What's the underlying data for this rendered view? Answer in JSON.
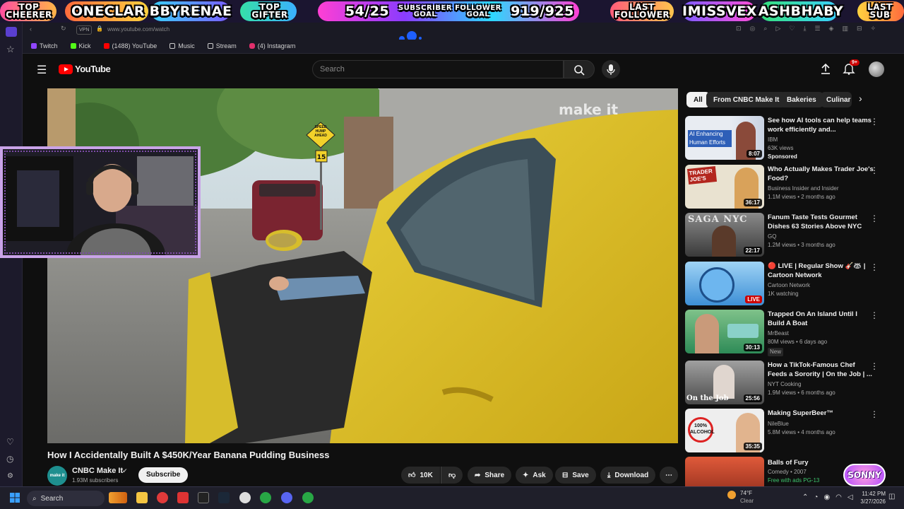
{
  "overlay": {
    "top_cheerer_label": "TOP\nCHEERER",
    "top_cheerer_name": "ONECLAR",
    "top_gifter_name_left": "BBYRENAE",
    "top_gifter_label": "TOP\nGIFTER",
    "sub_count": "54/25",
    "sub_goal_label": "SUBSCRIBER\nGOAL",
    "follower_goal_label": "FOLLOWER\nGOAL",
    "follower_count": "919/925",
    "last_follower_label": "LAST\nFOLLOWER",
    "last_follower_name": "IMISSVEX",
    "last_sub_name": "ASHBHABY",
    "last_sub_label": "LAST\nSUB"
  },
  "browser": {
    "vpn_badge": "VPN",
    "url": "www.youtube.com/watch",
    "bookmarks": [
      {
        "label": "Twitch",
        "color": "#9146ff"
      },
      {
        "label": "Kick",
        "color": "#53fc18"
      },
      {
        "label": "(1488) YouTube",
        "color": "#ff0000"
      },
      {
        "label": "Music",
        "color": "#cccccc"
      },
      {
        "label": "Stream",
        "color": "#cccccc"
      },
      {
        "label": "(4) Instagram",
        "color": "#e1306c"
      }
    ]
  },
  "header": {
    "logo_text": "YouTube",
    "search_placeholder": "Search",
    "notification_badge": "9+"
  },
  "video": {
    "watermark": "make it",
    "sign_text": "SPEED\nHUMP\nAHEAD",
    "speed_limit": "15",
    "title": "How I Accidentally Built A $450K/Year Banana Pudding Business",
    "channel_name": "CNBC Make It",
    "subscribers": "1.93M subscribers",
    "subscribe_label": "Subscribe",
    "likes": "10K",
    "share_label": "Share",
    "ask_label": "Ask",
    "save_label": "Save",
    "download_label": "Download"
  },
  "chips": [
    "All",
    "From CNBC Make It",
    "Bakeries",
    "Culinar"
  ],
  "recommendations": [
    {
      "title": "See how AI tools can help teams work efficiently and...",
      "channel": "IBM",
      "meta": "63K views",
      "extra": "Sponsored",
      "duration": "8:07",
      "thumb_color": "#2a4a8a",
      "thumb_text": "AI Enhancing Human Efforts"
    },
    {
      "title": "Who Actually Makes Trader Joe's Food?",
      "channel": "Business Insider and Insider",
      "meta": "1.1M views • 2 months ago",
      "extra": "",
      "duration": "36:17",
      "thumb_color": "#b3261e",
      "thumb_text": "TRADER JOE'S"
    },
    {
      "title": "Fanum Taste Tests Gourmet Dishes 63 Stories Above NYC",
      "channel": "GQ",
      "meta": "1.2M views • 3 months ago",
      "extra": "",
      "duration": "22:17",
      "thumb_color": "#3a3a3a",
      "thumb_text": "SAGA NYC"
    },
    {
      "title": "🔴 LIVE | Regular Show 🎸🦝 | Cartoon Network",
      "channel": "Cartoon Network",
      "meta": "1K watching",
      "extra": "",
      "duration": "LIVE",
      "thumb_color": "#5aa9e6",
      "thumb_text": ""
    },
    {
      "title": "Trapped On An Island Until I Build A Boat",
      "channel": "MrBeast",
      "meta": "80M views • 6 days ago",
      "extra": "New",
      "duration": "30:13",
      "thumb_color": "#2e8b57",
      "thumb_text": ""
    },
    {
      "title": "How a TikTok-Famous Chef Feeds a Sorority | On the Job | ...",
      "channel": "NYT Cooking",
      "meta": "1.9M views • 6 months ago",
      "extra": "",
      "duration": "25:56",
      "thumb_color": "#6f6f6f",
      "thumb_text": "On the Job"
    },
    {
      "title": "Making SuperBeer™",
      "channel": "NileBlue",
      "meta": "5.8M views • 4 months ago",
      "extra": "",
      "duration": "35:35",
      "thumb_color": "#d9d9d9",
      "thumb_text": "100% ALCOHOL"
    },
    {
      "title": "Balls of Fury",
      "channel": "Comedy • 2007",
      "meta": "Free with ads   PG-13",
      "extra": "",
      "duration": "",
      "thumb_color": "#c0392b",
      "thumb_text": ""
    }
  ],
  "taskbar": {
    "search_label": "Search",
    "weather_temp": "74°F",
    "weather_desc": "Clear",
    "time": "11:42 PM",
    "date": "3/27/2026"
  },
  "sonny_logo": "SONNY"
}
